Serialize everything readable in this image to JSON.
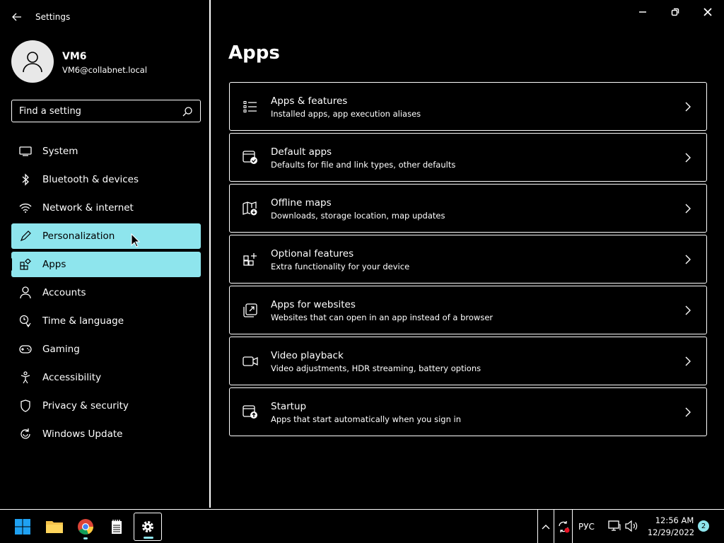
{
  "window": {
    "app_title": "Settings"
  },
  "user": {
    "name": "VM6",
    "email": "VM6@collabnet.local"
  },
  "search": {
    "placeholder": "Find a setting"
  },
  "sidebar": {
    "items": [
      {
        "label": "System",
        "icon": "monitor-icon"
      },
      {
        "label": "Bluetooth & devices",
        "icon": "bluetooth-icon"
      },
      {
        "label": "Network & internet",
        "icon": "wifi-icon"
      },
      {
        "label": "Personalization",
        "icon": "pen-icon"
      },
      {
        "label": "Apps",
        "icon": "apps-icon"
      },
      {
        "label": "Accounts",
        "icon": "person-icon"
      },
      {
        "label": "Time & language",
        "icon": "globe-clock-icon"
      },
      {
        "label": "Gaming",
        "icon": "gamepad-icon"
      },
      {
        "label": "Accessibility",
        "icon": "accessibility-icon"
      },
      {
        "label": "Privacy & security",
        "icon": "shield-icon"
      },
      {
        "label": "Windows Update",
        "icon": "update-icon"
      }
    ],
    "active_index": 4,
    "hover_index": 3,
    "highlight_color": "#8ee5ed"
  },
  "main": {
    "title": "Apps",
    "cards": [
      {
        "title": "Apps & features",
        "desc": "Installed apps, app execution aliases",
        "icon": "list-icon"
      },
      {
        "title": "Default apps",
        "desc": "Defaults for file and link types, other defaults",
        "icon": "default-apps-icon"
      },
      {
        "title": "Offline maps",
        "desc": "Downloads, storage location, map updates",
        "icon": "map-icon"
      },
      {
        "title": "Optional features",
        "desc": "Extra functionality for your device",
        "icon": "add-grid-icon"
      },
      {
        "title": "Apps for websites",
        "desc": "Websites that can open in an app instead of a browser",
        "icon": "open-external-icon"
      },
      {
        "title": "Video playback",
        "desc": "Video adjustments, HDR streaming, battery options",
        "icon": "video-camera-icon"
      },
      {
        "title": "Startup",
        "desc": "Apps that start automatically when you sign in",
        "icon": "startup-icon"
      }
    ]
  },
  "taskbar": {
    "apps": [
      "windows-start-icon",
      "file-explorer-icon",
      "chrome-icon",
      "notepad-icon",
      "settings-gear-icon"
    ],
    "language": "РУС",
    "time": "12:56 AM",
    "date": "12/29/2022",
    "notification_count": "2"
  }
}
